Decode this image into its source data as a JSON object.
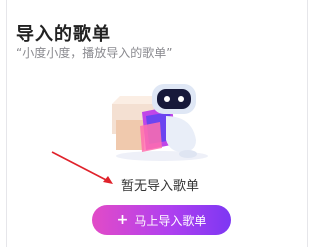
{
  "header": {
    "title": "导入的歌单",
    "subtitle": "“小度小度，播放导入的歌单”"
  },
  "empty_state": {
    "message": "暂无导入歌单",
    "illustration_icon": "robot-with-box-icon"
  },
  "annotation": {
    "arrow_color": "#e0222b"
  },
  "actions": {
    "import_label": "马上导入歌单",
    "import_icon": "plus-icon",
    "gradient_start": "#e24bc7",
    "gradient_end": "#7d37f3"
  }
}
